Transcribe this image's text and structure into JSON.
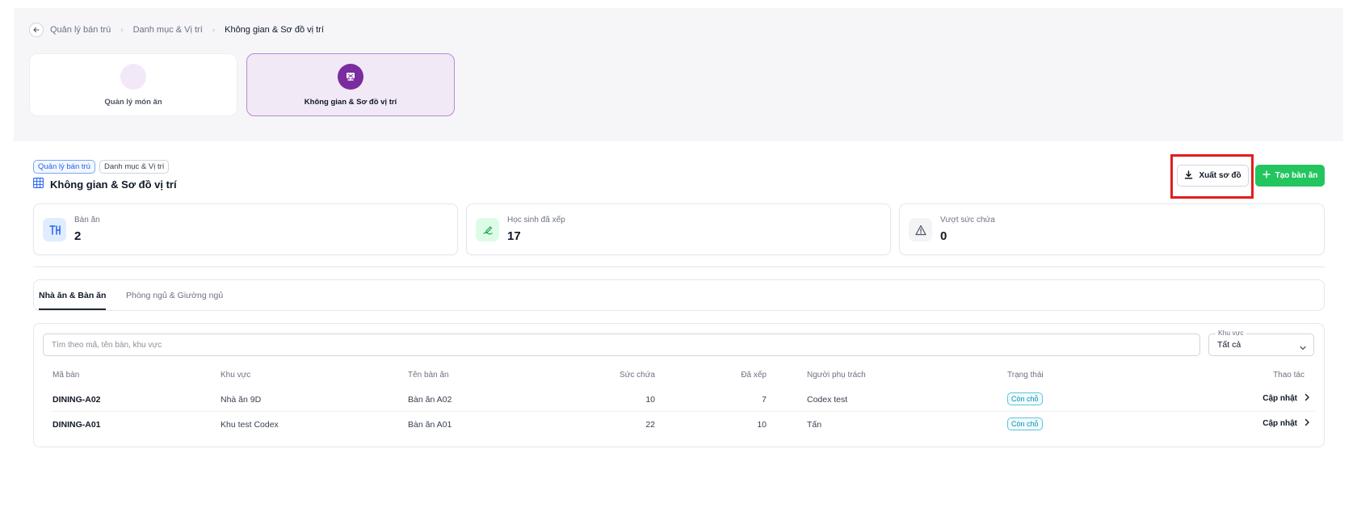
{
  "breadcrumb": {
    "items": [
      "Quản lý bán trú",
      "Danh mục & Vị trí",
      "Không gian & Sơ đồ vị trí"
    ]
  },
  "modules": [
    {
      "label": "Quản lý món ăn",
      "icon": "dish-icon",
      "active": false
    },
    {
      "label": "Không gian & Sơ đồ vị trí",
      "icon": "layout-map-icon",
      "active": true
    }
  ],
  "page": {
    "chips": [
      "Quản lý bán trú",
      "Danh mục & Vị trí"
    ],
    "title": "Không gian & Sơ đồ vị trí",
    "title_icon": "grid-icon"
  },
  "actions": {
    "export_label": "Xuất sơ đồ",
    "create_label": "Tạo bàn ăn"
  },
  "stats": [
    {
      "label": "Bàn ăn",
      "value": "2",
      "icon": "table-icon",
      "color": "#2563eb"
    },
    {
      "label": "Học sinh đã xếp",
      "value": "17",
      "icon": "student-icon",
      "color": "#16a34a"
    },
    {
      "label": "Vượt sức chứa",
      "value": "0",
      "icon": "warning-icon",
      "color": "#4b5563"
    }
  ],
  "tabs": [
    {
      "label": "Nhà ăn & Bàn ăn",
      "active": true
    },
    {
      "label": "Phòng ngủ & Giường ngủ",
      "active": false
    }
  ],
  "filters": {
    "search_placeholder": "Tìm theo mã, tên bàn, khu vực",
    "area_label": "Khu vực",
    "area_value": "Tất cả"
  },
  "table": {
    "columns": [
      "Mã bàn",
      "Khu vực",
      "Tên bàn ăn",
      "Sức chứa",
      "Đã xếp",
      "Người phụ trách",
      "Trạng thái",
      "Thao tác"
    ],
    "rows": [
      {
        "code": "DINING-A02",
        "area": "Nhà ăn 9D",
        "name": "Bàn ăn A02",
        "capacity": "10",
        "assigned": "7",
        "owner": "Codex test",
        "status": "Còn chỗ",
        "action": "Cập nhật"
      },
      {
        "code": "DINING-A01",
        "area": "Khu test Codex",
        "name": "Bàn ăn A01",
        "capacity": "22",
        "assigned": "10",
        "owner": "Tấn",
        "status": "Còn chỗ",
        "action": "Cập nhật"
      }
    ]
  },
  "colors": {
    "accent_purple": "#7b2c9e",
    "primary_green": "#22c55e",
    "highlight_red": "#e11d1d",
    "status_teal": "#0891b2"
  }
}
